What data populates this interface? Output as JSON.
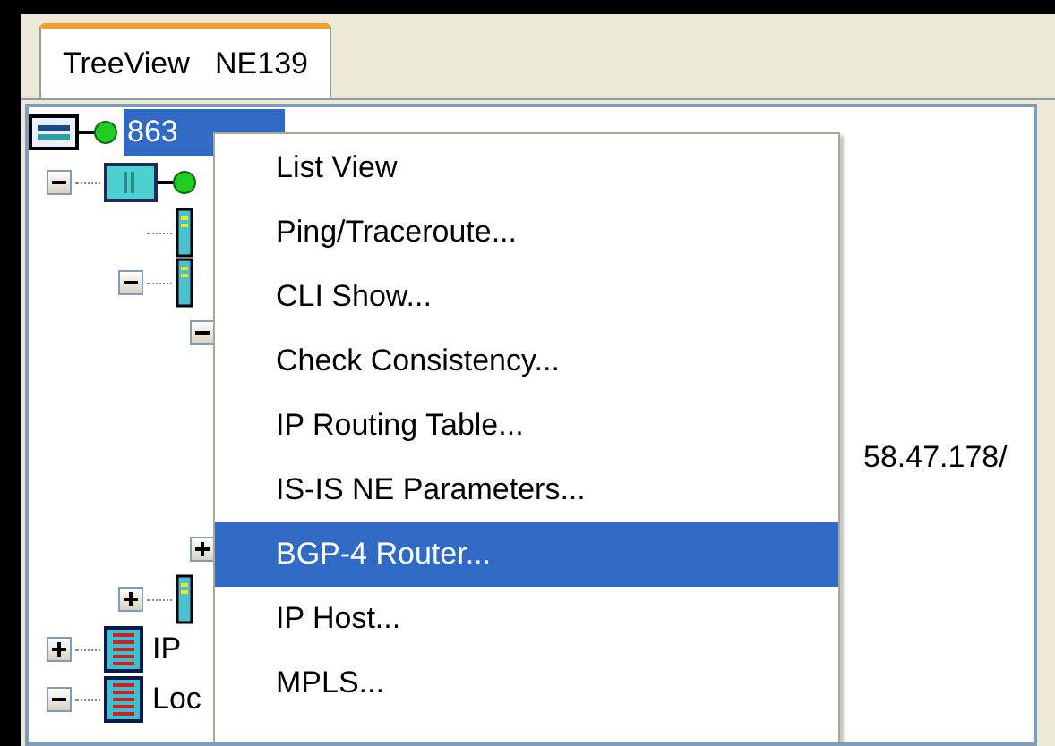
{
  "tab": {
    "label": "TreeView   NE139",
    "selected": true
  },
  "tree": [
    {
      "kind": "node",
      "label": "863",
      "selected": true,
      "children": [
        {
          "kind": "chassis",
          "expanded": true,
          "children": [
            {
              "kind": "card"
            },
            {
              "kind": "card",
              "expanded": true,
              "children": [
                {
                  "kind": "branch",
                  "expanded": true
                },
                {
                  "kind": "branch",
                  "expanded": false
                }
              ]
            },
            {
              "kind": "card",
              "expanded": false
            }
          ]
        },
        {
          "kind": "list",
          "label": "IP",
          "expanded": false
        },
        {
          "kind": "list",
          "label": "Loc",
          "expanded": true
        }
      ]
    }
  ],
  "hidden_row_text": "58.47.178/",
  "context_menu": [
    {
      "label": "List View",
      "selected": false
    },
    {
      "label": "Ping/Traceroute...",
      "selected": false
    },
    {
      "label": "CLI Show...",
      "selected": false
    },
    {
      "label": "Check Consistency...",
      "selected": false
    },
    {
      "label": "IP Routing Table...",
      "selected": false
    },
    {
      "label": "IS-IS NE Parameters...",
      "selected": false
    },
    {
      "label": "BGP-4 Router...",
      "selected": true
    },
    {
      "label": "IP Host...",
      "selected": false
    },
    {
      "label": "MPLS...",
      "selected": false
    }
  ]
}
